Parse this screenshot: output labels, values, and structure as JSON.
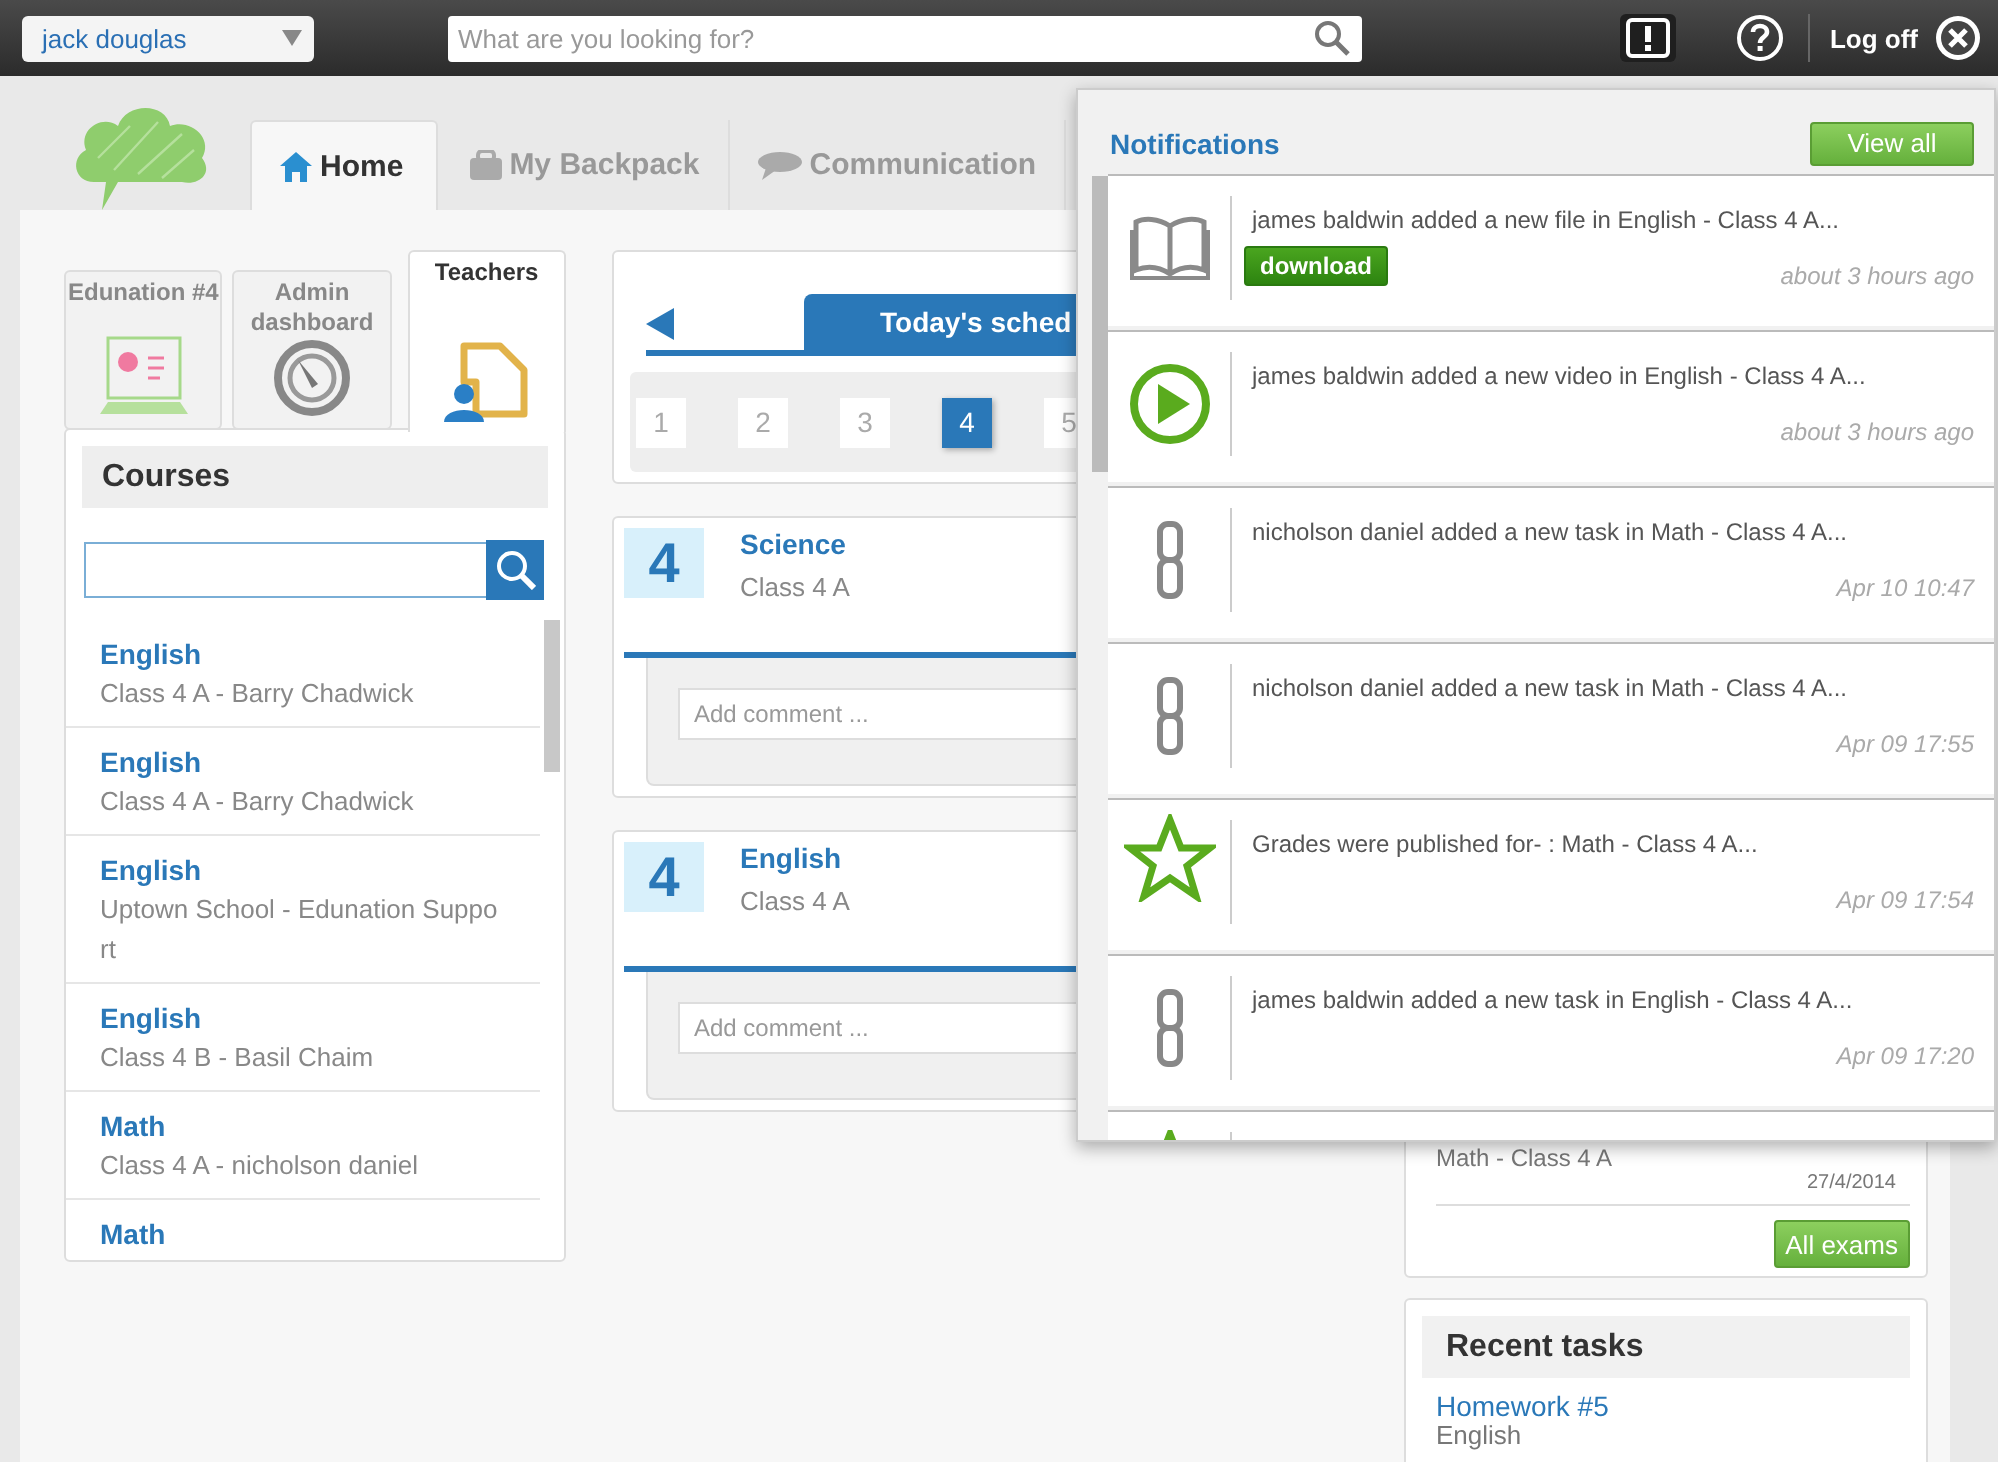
{
  "topbar": {
    "user": "jack douglas",
    "search_placeholder": "What are you looking for?",
    "logoff": "Log off",
    "alerts_active": true
  },
  "tabs": [
    {
      "label": "Home",
      "kind": "home",
      "selected": true
    },
    {
      "label": "My Backpack",
      "kind": "bag",
      "selected": false
    },
    {
      "label": "Communication",
      "kind": "chat",
      "selected": false
    }
  ],
  "tiles": [
    {
      "label": "Edunation #4",
      "kind": "screen",
      "selected": false
    },
    {
      "label": "Admin dashboard",
      "kind": "gauge",
      "selected": false
    },
    {
      "label": "Teachers",
      "kind": "teacher",
      "selected": true
    }
  ],
  "courses": {
    "title": "Courses",
    "items": [
      {
        "name": "English",
        "detail": "Class 4 A - Barry Chadwick"
      },
      {
        "name": "English",
        "detail": "Class 4 A - Barry Chadwick"
      },
      {
        "name": "English",
        "detail": "Uptown School - Edunation Suppo rt"
      },
      {
        "name": "English",
        "detail": "Class 4 B - Basil Chaim"
      },
      {
        "name": "Math",
        "detail": "Class 4 A - nicholson daniel"
      },
      {
        "name": "Math"
      }
    ]
  },
  "schedule": {
    "title": "Today's sched",
    "days": [
      {
        "label": "1",
        "selected": false
      },
      {
        "label": "2",
        "selected": false
      },
      {
        "label": "3",
        "selected": false
      },
      {
        "label": "4",
        "selected": true
      },
      {
        "label": "5",
        "selected": false
      }
    ]
  },
  "lessons": [
    {
      "number": "4",
      "subject": "Science",
      "class": "Class 4 A",
      "comment_placeholder": "Add comment ..."
    },
    {
      "number": "4",
      "subject": "English",
      "class": "Class 4 A",
      "comment_placeholder": "Add comment ..."
    }
  ],
  "exams": {
    "class": "Math - Class 4 A",
    "date": "27/4/2014",
    "button": "All exams"
  },
  "recent_tasks": {
    "title": "Recent tasks",
    "items": [
      {
        "name": "Homework #5",
        "subject": "English"
      }
    ]
  },
  "notifications": {
    "title": "Notifications",
    "view_all": "View all",
    "items": [
      {
        "kind": "book",
        "text": "james baldwin added a new file in English - Class 4 A...",
        "action": "download",
        "time": "about 3 hours ago"
      },
      {
        "kind": "play",
        "text": "james baldwin added a new video in English - Class 4 A...",
        "time": "about 3 hours ago"
      },
      {
        "kind": "link",
        "text": "nicholson daniel added a new task in Math - Class 4 A...",
        "time": "Apr 10 10:47"
      },
      {
        "kind": "link",
        "text": "nicholson daniel added a new task in Math - Class 4 A...",
        "time": "Apr 09 17:55"
      },
      {
        "kind": "star",
        "text": "Grades were published for- : Math - Class 4 A...",
        "time": "Apr 09 17:54"
      },
      {
        "kind": "link",
        "text": "james baldwin added a new task in English - Class 4 A...",
        "time": "Apr 09 17:20"
      },
      {
        "kind": "star"
      }
    ]
  }
}
